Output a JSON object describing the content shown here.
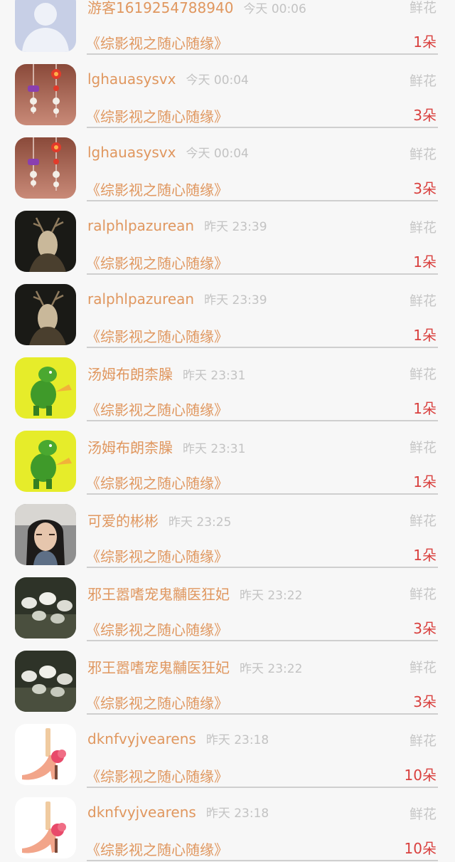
{
  "rows": [
    {
      "avatar": "default-avatar",
      "username": "游客1619254788940",
      "time": "今天 00:06",
      "gift_type": "鲜花",
      "book": "《综影视之随心随缘》",
      "quantity": "1朵"
    },
    {
      "avatar": "ornament-avatar",
      "username": "lghauasysvx",
      "time": "今天 00:04",
      "gift_type": "鲜花",
      "book": "《综影视之随心随缘》",
      "quantity": "3朵"
    },
    {
      "avatar": "ornament-avatar",
      "username": "lghauasysvx",
      "time": "今天 00:04",
      "gift_type": "鲜花",
      "book": "《综影视之随心随缘》",
      "quantity": "3朵"
    },
    {
      "avatar": "deer-portrait-avatar",
      "username": "ralphlpazurean",
      "time": "昨天 23:39",
      "gift_type": "鲜花",
      "book": "《综影视之随心随缘》",
      "quantity": "1朵"
    },
    {
      "avatar": "deer-portrait-avatar",
      "username": "ralphlpazurean",
      "time": "昨天 23:39",
      "gift_type": "鲜花",
      "book": "《综影视之随心随缘》",
      "quantity": "1朵"
    },
    {
      "avatar": "green-dinosaur-avatar",
      "username": "汤姆布朗柰臊",
      "time": "昨天 23:31",
      "gift_type": "鲜花",
      "book": "《综影视之随心随缘》",
      "quantity": "1朵"
    },
    {
      "avatar": "green-dinosaur-avatar",
      "username": "汤姆布朗柰臊",
      "time": "昨天 23:31",
      "gift_type": "鲜花",
      "book": "《综影视之随心随缘》",
      "quantity": "1朵"
    },
    {
      "avatar": "person-photo-avatar",
      "username": "可爱的彬彬",
      "time": "昨天 23:25",
      "gift_type": "鲜花",
      "book": "《综影视之随心随缘》",
      "quantity": "1朵"
    },
    {
      "avatar": "birds-photo-avatar",
      "username": "邪王嚣嗜宠鬼黼医狂妃",
      "time": "昨天 23:22",
      "gift_type": "鲜花",
      "book": "《综影视之随心随缘》",
      "quantity": "3朵"
    },
    {
      "avatar": "birds-photo-avatar",
      "username": "邪王嚣嗜宠鬼黼医狂妃",
      "time": "昨天 23:22",
      "gift_type": "鲜花",
      "book": "《综影视之随心随缘》",
      "quantity": "3朵"
    },
    {
      "avatar": "high-heel-shoe-avatar",
      "username": "dknfvyjvearens",
      "time": "昨天 23:18",
      "gift_type": "鲜花",
      "book": "《综影视之随心随缘》",
      "quantity": "10朵"
    },
    {
      "avatar": "high-heel-shoe-avatar",
      "username": "dknfvyjvearens",
      "time": "昨天 23:18",
      "gift_type": "鲜花",
      "book": "《综影视之随心随缘》",
      "quantity": "10朵"
    }
  ]
}
